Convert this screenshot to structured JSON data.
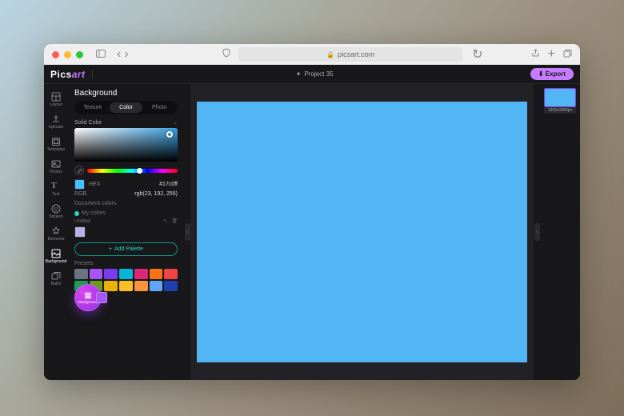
{
  "browser": {
    "url": "picsart.com"
  },
  "app": {
    "logo": "Picsart",
    "project_name": "Project 35",
    "export_label": "Export"
  },
  "rail": {
    "items": [
      {
        "label": "Layout"
      },
      {
        "label": "Uploads"
      },
      {
        "label": "Templates"
      },
      {
        "label": "Photos"
      },
      {
        "label": "Text"
      },
      {
        "label": "Stickers"
      },
      {
        "label": "Elements"
      },
      {
        "label": "Background"
      },
      {
        "label": "Batch"
      }
    ]
  },
  "panel": {
    "title": "Background",
    "tabs": {
      "texture": "Texture",
      "color": "Color",
      "photo": "Photo"
    },
    "solid_color_label": "Solid Color",
    "hex_label": "HEX",
    "hex_value": "#17c0ff",
    "rgb_label": "RGB",
    "rgb_value": "rgb(23, 192, 255)",
    "document_colors_label": "Document colors",
    "my_colors_label": "My colors",
    "untitled_label": "Untitled",
    "add_palette_label": "Add Palette",
    "presets_label": "Presets",
    "preset_colors": [
      "#6b7280",
      "#a855f7",
      "#7c3aed",
      "#06b6d4",
      "#db2777",
      "#f97316",
      "#ef4444",
      "#16a34a",
      "#65a30d",
      "#eab308",
      "#fbbf24",
      "#fb923c",
      "#60a5fa",
      "#1e40af"
    ]
  },
  "thumb": {
    "label": "1920x1080px"
  },
  "floating": {
    "label": "Background"
  },
  "colors": {
    "canvas": "#52b6f4",
    "accent_purple": "#c77dff"
  }
}
